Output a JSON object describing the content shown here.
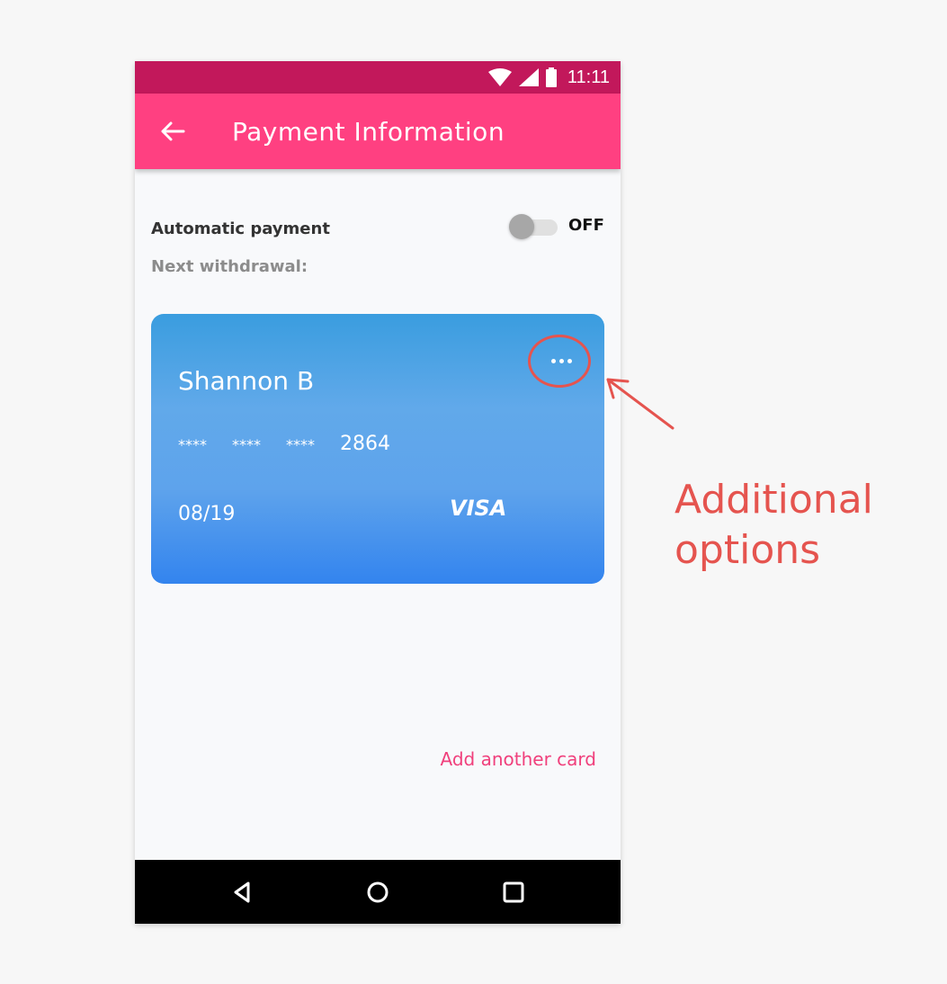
{
  "status_bar": {
    "time": "11:11"
  },
  "app_bar": {
    "title": "Payment Information"
  },
  "payment": {
    "automatic_label": "Automatic payment",
    "toggle_state": "OFF",
    "next_withdrawal_label": "Next withdrawal:"
  },
  "card": {
    "holder": "Shannon B",
    "masked_groups": [
      "****",
      "****",
      "****"
    ],
    "last4": "2864",
    "expiry": "08/19",
    "brand": "VISA"
  },
  "actions": {
    "add_card": "Add another card"
  },
  "annotation": {
    "text": "Additional options"
  },
  "colors": {
    "status_bar": "#c2185b",
    "app_bar": "#ff4081",
    "accent_text": "#f0407c",
    "annotation": "#e5544f"
  }
}
